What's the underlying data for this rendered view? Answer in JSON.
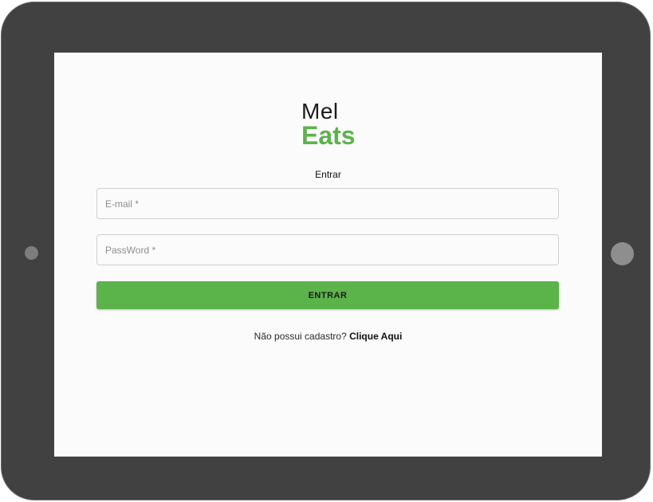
{
  "logo": {
    "line1": "Mel",
    "line2": "Eats"
  },
  "form": {
    "title": "Entrar",
    "email_placeholder": "E-mail *",
    "password_placeholder": "PassWord *",
    "submit_label": "ENTRAR"
  },
  "signup": {
    "prompt": "Não possui cadastro?",
    "link_label": "Clique Aqui"
  },
  "colors": {
    "brand_green": "#5bb449",
    "device_frame": "#414141",
    "screen_bg": "#fcfbfc"
  }
}
